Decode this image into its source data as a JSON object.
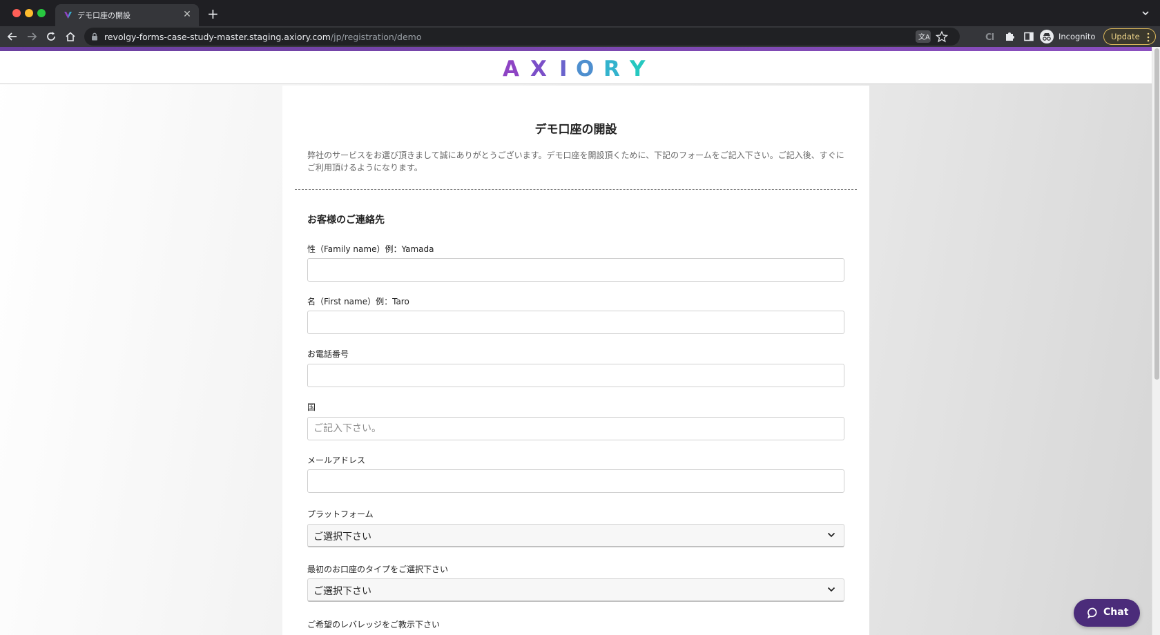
{
  "browser": {
    "tab_title": "デモ口座の開設",
    "url_host": "revolgy-forms-case-study-master.staging.axiory.com",
    "url_path": "/jp/registration/demo",
    "profile_label": "Incognito",
    "update_label": "Update"
  },
  "site": {
    "logo_letters": [
      "A",
      "X",
      "I",
      "O",
      "R",
      "Y"
    ],
    "logo_colors": [
      "#8e44c4",
      "#7b4fc8",
      "#6a63cc",
      "#4e8fcf",
      "#33b3cd",
      "#25c8c0"
    ],
    "accent_color": "#6a3f9e"
  },
  "form": {
    "title": "デモ口座の開設",
    "intro_line1": "弊社のサービスをお選び頂きまして誠にありがとうございます。デモ口座を開設頂くために、下記のフォームをご記入下さい。ご記入後、すぐに",
    "intro_line2": "ご利用頂けるようになります。",
    "section_title": "お客様のご連絡先",
    "fields": {
      "family_name": {
        "label": "性（Family name）例：Yamada",
        "value": "",
        "placeholder": ""
      },
      "first_name": {
        "label": "名（First name）例：Taro",
        "value": "",
        "placeholder": ""
      },
      "phone": {
        "label": "お電話番号",
        "value": "",
        "placeholder": ""
      },
      "country": {
        "label": "国",
        "value": "",
        "placeholder": "ご記入下さい。"
      },
      "email": {
        "label": "メールアドレス",
        "value": "",
        "placeholder": ""
      },
      "platform": {
        "label": "プラットフォーム",
        "selected": "ご選択下さい"
      },
      "account_type": {
        "label": "最初のお口座のタイプをご選択下さい",
        "selected": "ご選択下さい"
      },
      "leverage": {
        "label": "ご希望のレバレッジをご教示下さい"
      }
    }
  },
  "chat": {
    "label": "Chat",
    "color": "#4b2c7a"
  }
}
